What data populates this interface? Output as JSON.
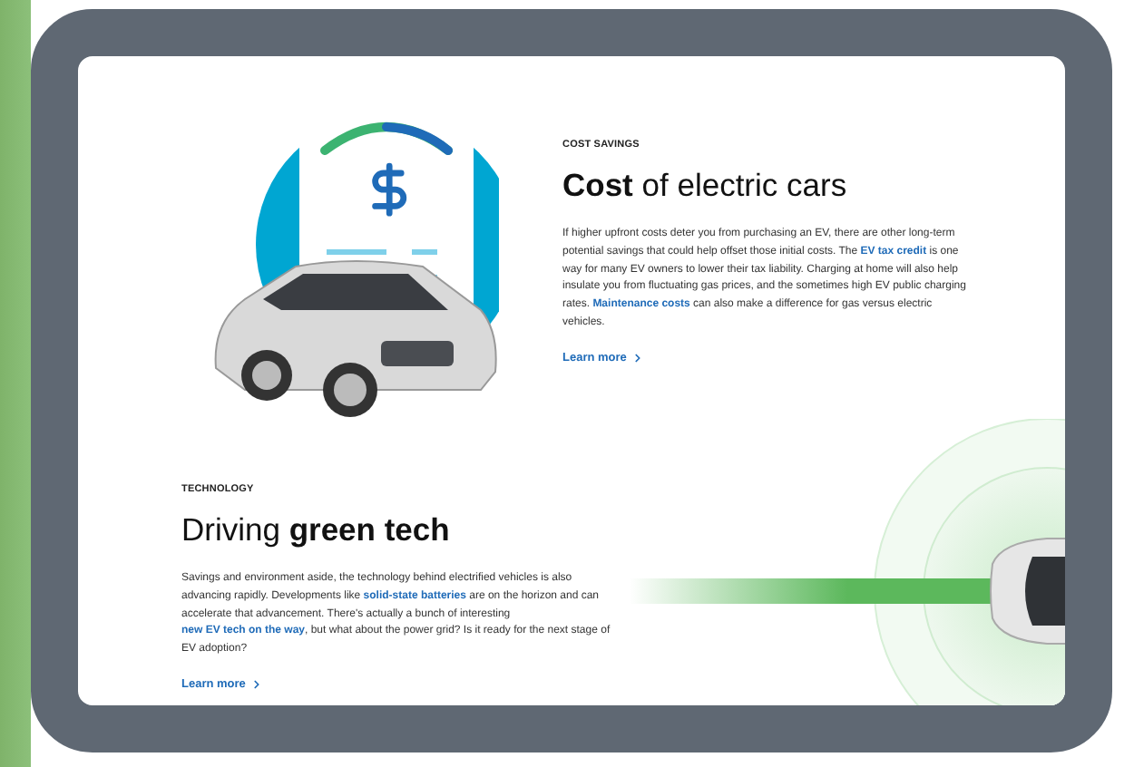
{
  "sections": [
    {
      "kind": "savings",
      "eyebrow": "COST SAVINGS",
      "heading": "**Cost** of electric cars",
      "paragraph": [
        {
          "kind": "text",
          "text": "If higher upfront costs deter you from purchasing an EV, there are other long-term potential savings that could help offset those initial costs. The "
        },
        {
          "kind": "link",
          "text": "EV tax credit"
        },
        {
          "kind": "text",
          "text": " is one way for many EV owners to lower their tax liability. Charging at home will also help insulate you from fluctuating gas prices, and the sometimes high EV public charging rates. "
        },
        {
          "kind": "link",
          "text": "Maintenance costs"
        },
        {
          "kind": "text",
          "text": " can also make a difference for gas versus electric vehicles."
        }
      ],
      "learn_more": "Learn more"
    },
    {
      "kind": "car-top",
      "eyebrow": "TECHNOLOGY",
      "heading": "Driving **green tech**",
      "paragraph": [
        {
          "kind": "text",
          "text": "Savings and environment aside, the technology behind electrified vehicles is also advancing rapidly.  Developments like "
        },
        {
          "kind": "link",
          "text": "solid-state batteries"
        },
        {
          "kind": "text",
          "text": " are on the horizon and can accelerate that advancement. There's actually a bunch of interesting "
        },
        {
          "kind": "link",
          "text": "new EV tech on the way"
        },
        {
          "kind": "text",
          "text": ", but what about the power grid? Is it ready for the next stage of EV adoption?"
        }
      ],
      "learn_more": "Learn more"
    }
  ]
}
